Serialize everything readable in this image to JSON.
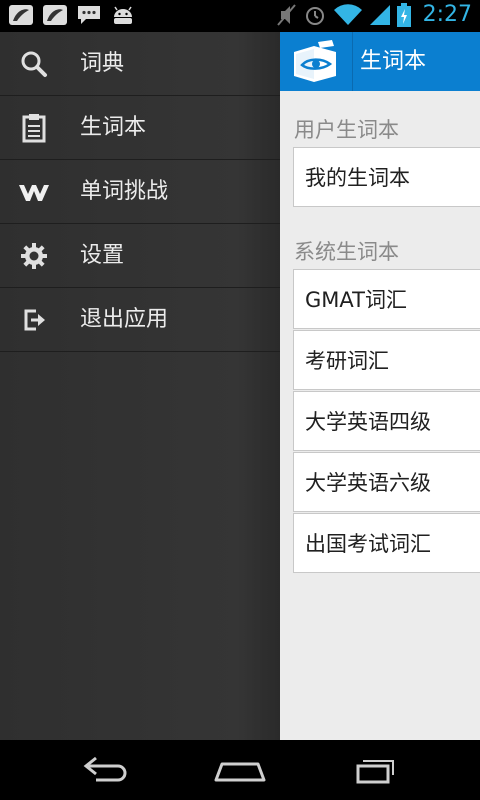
{
  "status_bar": {
    "time": "2:27",
    "left_icons": [
      "leaf-notification-icon",
      "leaf-notification-icon",
      "chat-icon",
      "android-icon"
    ],
    "right_icons": [
      "mute-icon",
      "alarm-icon",
      "wifi-icon",
      "signal-icon",
      "battery-charging-icon"
    ]
  },
  "drawer": {
    "items": [
      {
        "label": "词典",
        "icon": "search-icon"
      },
      {
        "label": "生词本",
        "icon": "clipboard-icon"
      },
      {
        "label": "单词挑战",
        "icon": "w-icon"
      },
      {
        "label": "设置",
        "icon": "gear-icon"
      },
      {
        "label": "退出应用",
        "icon": "exit-icon"
      }
    ]
  },
  "action_bar": {
    "title": "生词本",
    "logo_icon": "book-logo-icon",
    "color": "#0b7fd0"
  },
  "user_section": {
    "title": "用户生词本",
    "items": [
      "我的生词本"
    ]
  },
  "system_section": {
    "title": "系统生词本",
    "items": [
      "GMAT词汇",
      "考研词汇",
      "大学英语四级",
      "大学英语六级",
      "出国考试词汇"
    ]
  },
  "nav_bar": {
    "buttons": [
      "back-icon",
      "home-icon",
      "recents-icon"
    ]
  },
  "colors": {
    "accent": "#33b5e5",
    "drawer_bg": "#333333",
    "content_bg": "#ececec"
  }
}
